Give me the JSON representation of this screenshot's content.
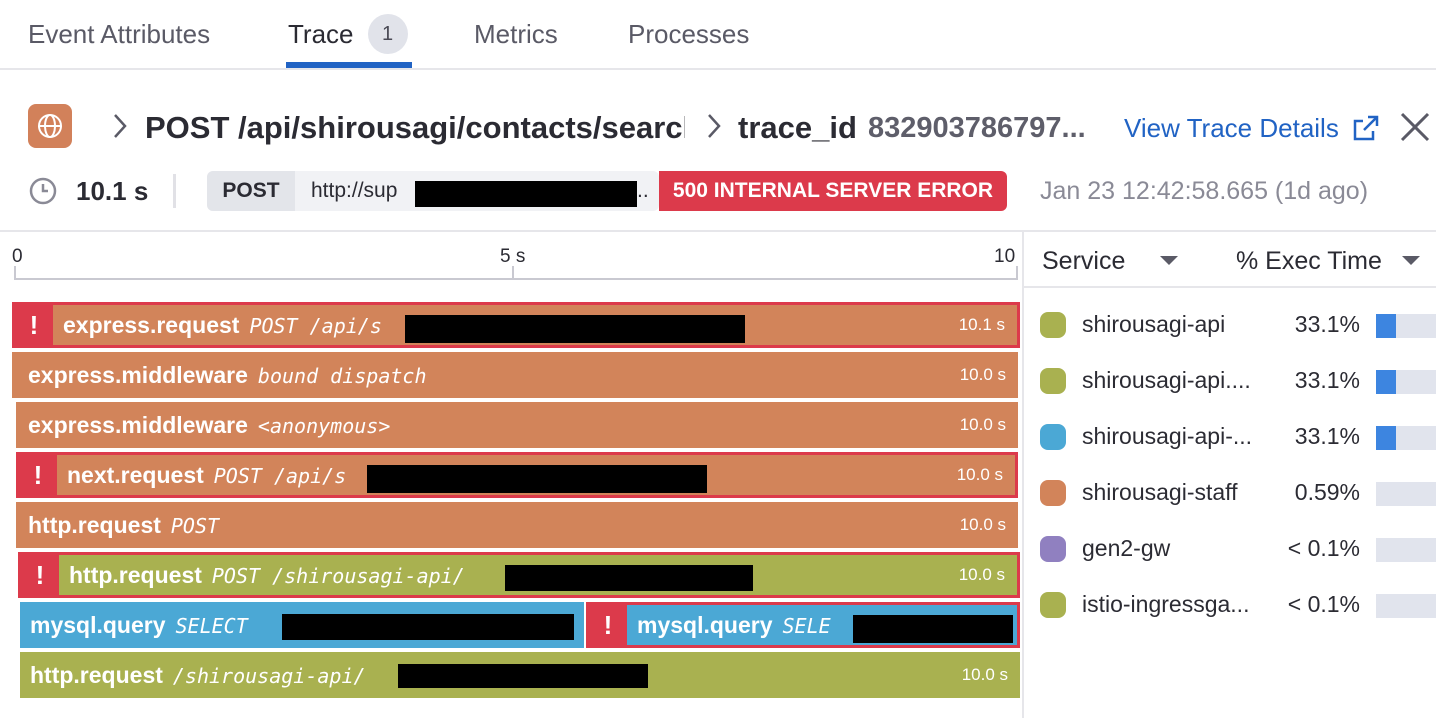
{
  "tabs": [
    {
      "label": "Event Attributes"
    },
    {
      "label": "Trace",
      "badge": "1",
      "active": true
    },
    {
      "label": "Metrics"
    },
    {
      "label": "Processes"
    }
  ],
  "header": {
    "service_icon": "globe-icon",
    "route": "POST /api/shirousagi/contacts/search",
    "trace_label": "trace_id",
    "trace_id": "832903786797...",
    "view_details": "View Trace Details"
  },
  "info": {
    "duration": "10.1 s",
    "method": "POST",
    "url_prefix": "http://sup",
    "url_suffix": "..",
    "status": "500 INTERNAL SERVER ERROR",
    "timestamp": "Jan 23 12:42:58.665 (1d ago)"
  },
  "axis": {
    "start": "0",
    "mid": "5 s",
    "end": "10"
  },
  "spans": [
    {
      "name": "express.request",
      "resource": "POST /api/s",
      "duration": "10.1 s",
      "error": true,
      "color": "#d2845a"
    },
    {
      "name": "express.middleware",
      "resource": "bound dispatch",
      "duration": "10.0 s",
      "error": false,
      "color": "#d2845a"
    },
    {
      "name": "express.middleware",
      "resource": "<anonymous>",
      "duration": "10.0 s",
      "error": false,
      "color": "#d2845a"
    },
    {
      "name": "next.request",
      "resource": "POST /api/s",
      "duration": "10.0 s",
      "error": true,
      "color": "#d2845a"
    },
    {
      "name": "http.request",
      "resource": "POST",
      "duration": "10.0 s",
      "error": false,
      "color": "#d2845a"
    },
    {
      "name": "http.request",
      "resource": "POST /shirousagi-api/",
      "duration": "10.0 s",
      "error": true,
      "color": "#a9b150"
    },
    {
      "name": "mysql.query",
      "resource": "SELECT",
      "duration": "",
      "error": false,
      "color": "#4ba8d5"
    },
    {
      "name": "mysql.query",
      "resource": "SELE",
      "duration": "",
      "error": true,
      "color": "#4ba8d5"
    },
    {
      "name": "http.request",
      "resource": "/shirousagi-api/",
      "duration": "10.0 s",
      "error": false,
      "color": "#a9b150"
    }
  ],
  "service_panel": {
    "col_service": "Service",
    "col_exec": "% Exec Time",
    "rows": [
      {
        "name": "shirousagi-api",
        "pct": "33.1%",
        "share": 0.331,
        "color": "#a9b150"
      },
      {
        "name": "shirousagi-api....",
        "pct": "33.1%",
        "share": 0.331,
        "color": "#a9b150"
      },
      {
        "name": "shirousagi-api-...",
        "pct": "33.1%",
        "share": 0.331,
        "color": "#4ba8d5"
      },
      {
        "name": "shirousagi-staff",
        "pct": "0.59%",
        "share": 0.0059,
        "color": "#d2845a"
      },
      {
        "name": "gen2-gw",
        "pct": "< 0.1%",
        "share": 0.0,
        "color": "#9080c0"
      },
      {
        "name": "istio-ingressga...",
        "pct": "< 0.1%",
        "share": 0.0,
        "color": "#a9b150"
      }
    ]
  }
}
